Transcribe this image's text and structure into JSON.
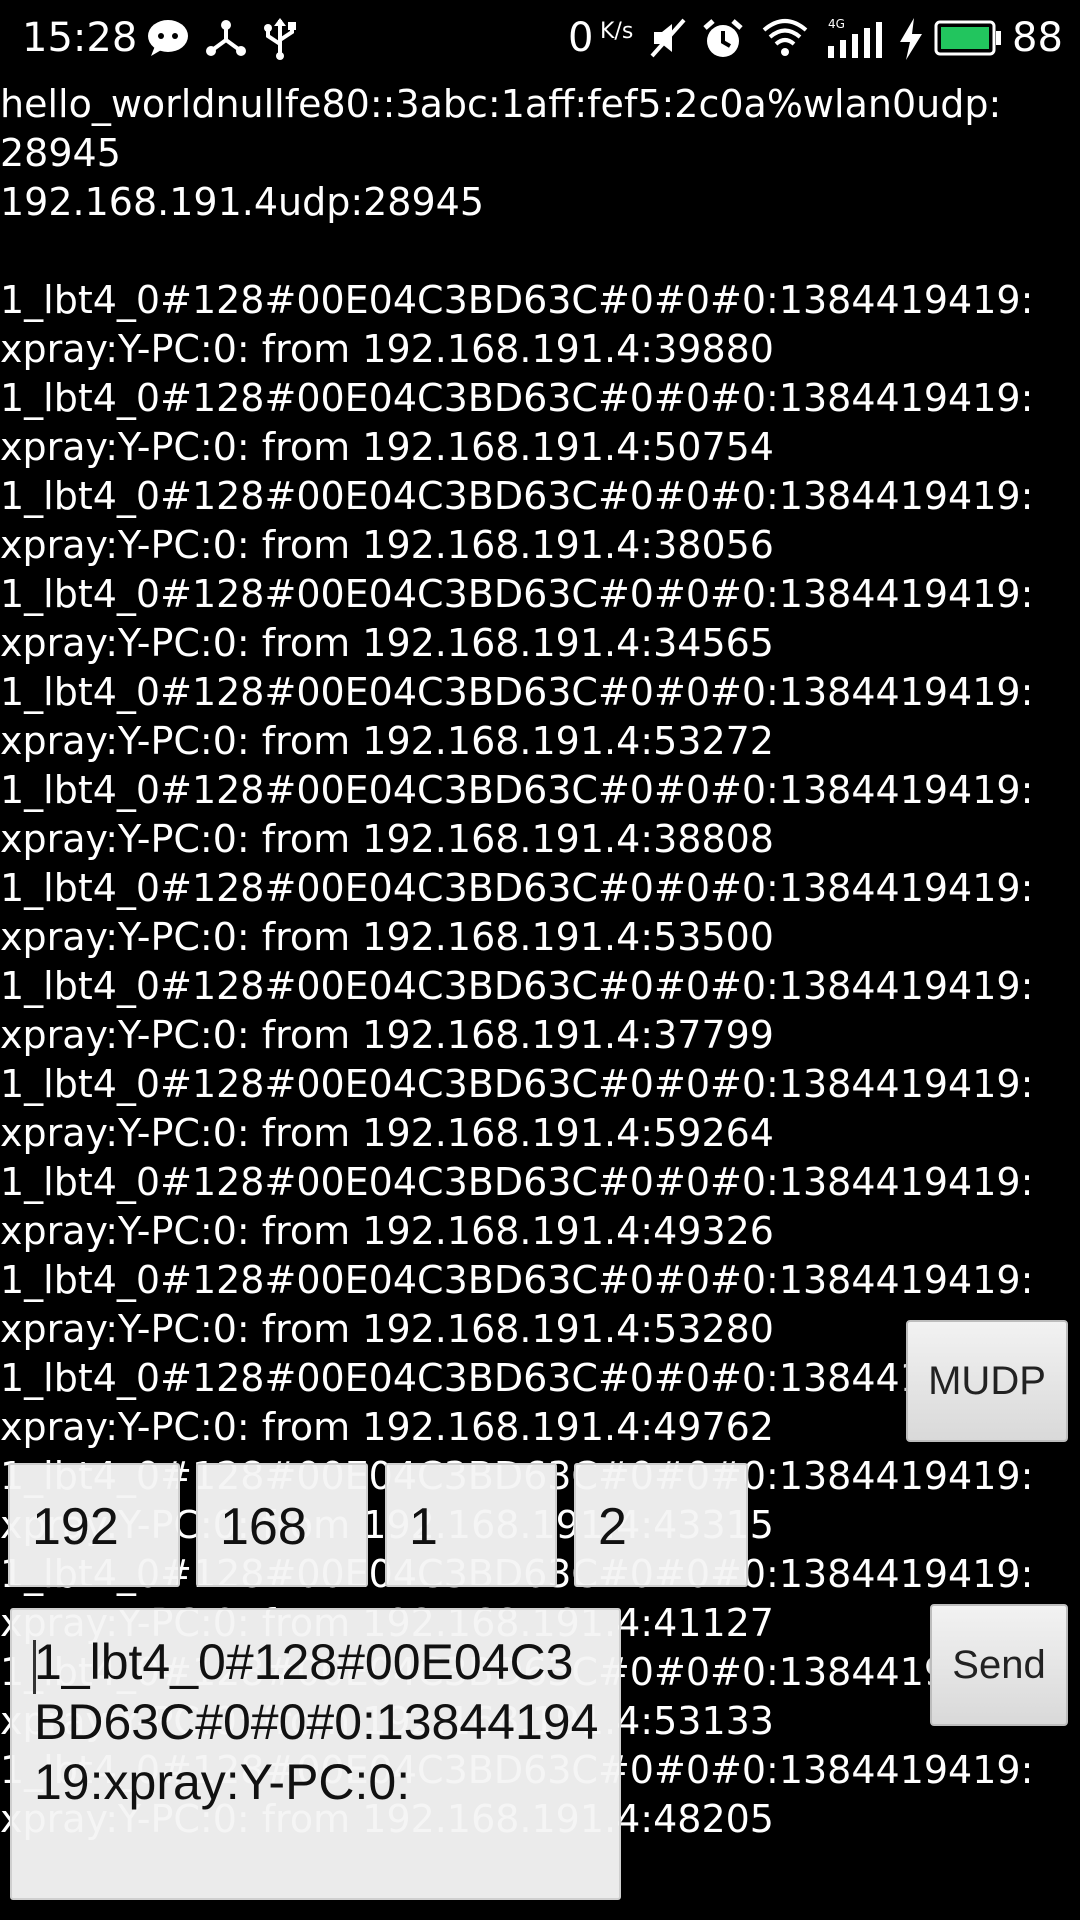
{
  "status_bar": {
    "time": "15:28",
    "net_speed_value": "0",
    "net_speed_unit": "K/s",
    "battery_level": "88",
    "network_type": "4G",
    "icons": [
      "chat-icon",
      "share-icon",
      "usb-icon",
      "mute-icon",
      "alarm-icon",
      "wifi-icon",
      "signal-icon",
      "charging-icon",
      "battery-icon"
    ],
    "battery_color": "#22c55e"
  },
  "log": {
    "lines": [
      "hello_worldnullfe80::3abc:1aff:fef5:2c0a%wlan0udp:",
      "28945",
      "192.168.191.4udp:28945",
      "",
      "1_lbt4_0#128#00E04C3BD63C#0#0#0:1384419419:",
      "xpray:Y-PC:0: from 192.168.191.4:39880",
      "1_lbt4_0#128#00E04C3BD63C#0#0#0:1384419419:",
      "xpray:Y-PC:0: from 192.168.191.4:50754",
      "1_lbt4_0#128#00E04C3BD63C#0#0#0:1384419419:",
      "xpray:Y-PC:0: from 192.168.191.4:38056",
      "1_lbt4_0#128#00E04C3BD63C#0#0#0:1384419419:",
      "xpray:Y-PC:0: from 192.168.191.4:34565",
      "1_lbt4_0#128#00E04C3BD63C#0#0#0:1384419419:",
      "xpray:Y-PC:0: from 192.168.191.4:53272",
      "1_lbt4_0#128#00E04C3BD63C#0#0#0:1384419419:",
      "xpray:Y-PC:0: from 192.168.191.4:38808",
      "1_lbt4_0#128#00E04C3BD63C#0#0#0:1384419419:",
      "xpray:Y-PC:0: from 192.168.191.4:53500",
      "1_lbt4_0#128#00E04C3BD63C#0#0#0:1384419419:",
      "xpray:Y-PC:0: from 192.168.191.4:37799",
      "1_lbt4_0#128#00E04C3BD63C#0#0#0:1384419419:",
      "xpray:Y-PC:0: from 192.168.191.4:59264",
      "1_lbt4_0#128#00E04C3BD63C#0#0#0:1384419419:",
      "xpray:Y-PC:0: from 192.168.191.4:49326",
      "1_lbt4_0#128#00E04C3BD63C#0#0#0:1384419419:",
      "xpray:Y-PC:0: from 192.168.191.4:53280",
      "1_lbt4_0#128#00E04C3BD63C#0#0#0:1384419419:",
      "xpray:Y-PC:0: from 192.168.191.4:49762",
      "1_lbt4_0#128#00E04C3BD63C#0#0#0:1384419419:",
      "xpray:Y-PC:0: from 192.168.191.4:43315",
      "1_lbt4_0#128#00E04C3BD63C#0#0#0:1384419419:",
      "xpray:Y-PC:0: from 192.168.191.4:41127",
      "1_lbt4_0#128#00E04C3BD63C#0#0#0:1384419419:",
      "xpray:Y-PC:0: from 192.168.191.4:53133",
      "1_lbt4_0#128#00E04C3BD63C#0#0#0:1384419419:",
      "xpray:Y-PC:0: from 192.168.191.4:48205"
    ]
  },
  "controls": {
    "mudp_label": "MUDP",
    "send_label": "Send",
    "ip_octets": [
      "192",
      "168",
      "1",
      "2"
    ],
    "message_text": "1_lbt4_0#128#00E04C3BD63C#0#0#0:1384419419:xpray:Y-PC:0:"
  }
}
